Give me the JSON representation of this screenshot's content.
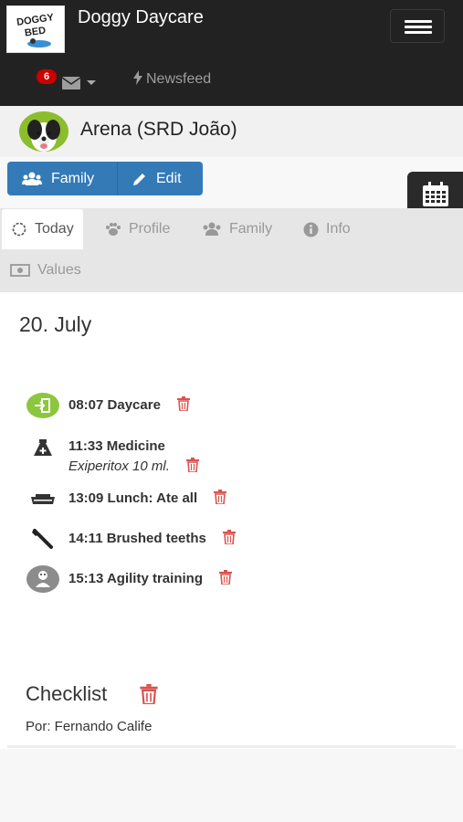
{
  "app": {
    "logo_text_line1": "DOGGY",
    "logo_text_line2": "BED",
    "brand": "Doggy Daycare"
  },
  "nav": {
    "messages_badge": "6",
    "newsfeed_label": "Newsfeed"
  },
  "pet": {
    "name": "Arena (SRD João)"
  },
  "actions": {
    "family_label": "Family",
    "edit_label": "Edit"
  },
  "tabs": [
    {
      "label": "Today",
      "icon": "sun-icon",
      "active": true
    },
    {
      "label": "Profile",
      "icon": "paw-icon"
    },
    {
      "label": "Family",
      "icon": "users-icon"
    },
    {
      "label": "Info",
      "icon": "info-icon"
    },
    {
      "label": "Values",
      "icon": "money-icon"
    }
  ],
  "day": {
    "date": "20. July",
    "events": [
      {
        "text": "08:07 Daycare",
        "icon": "check-in-icon"
      },
      {
        "text": "11:33 Medicine",
        "subtext": "Exiperitox 10 ml.",
        "icon": "medicine-icon"
      },
      {
        "text": "13:09 Lunch: Ate all",
        "icon": "food-bowl-icon"
      },
      {
        "text": "14:11 Brushed teeths",
        "icon": "toothbrush-icon"
      },
      {
        "text": "15:13 Agility training",
        "icon": "agility-icon"
      }
    ]
  },
  "checklist": {
    "title": "Checklist",
    "by": "Por: Fernando Calife"
  },
  "colors": {
    "navbar": "#222222",
    "primary": "#337ab7",
    "danger": "#d9534f",
    "checkin": "#8cc63f"
  }
}
